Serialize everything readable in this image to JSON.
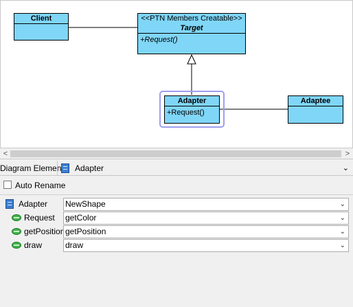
{
  "diagram": {
    "client": {
      "name": "Client"
    },
    "target": {
      "stereotype": "<<PTN Members Creatable>>",
      "name": "Target",
      "operation": "+Request()"
    },
    "adapter": {
      "name": "Adapter",
      "operation": "+Request()"
    },
    "adaptee": {
      "name": "Adaptee"
    }
  },
  "scrollbar": {
    "left_arrow": "<",
    "right_arrow": ">"
  },
  "properties": {
    "header_label": "Diagram Element",
    "selected_element": "Adapter",
    "auto_rename_label": "Auto Rename",
    "auto_rename_checked": false,
    "rows": [
      {
        "icon": "class-icon",
        "label": "Adapter",
        "value": "NewShape"
      },
      {
        "icon": "operation-icon",
        "label": "Request",
        "value": "getColor"
      },
      {
        "icon": "operation-icon",
        "label": "getPosition",
        "value": "getPosition"
      },
      {
        "icon": "operation-icon",
        "label": "draw",
        "value": "draw"
      }
    ]
  },
  "colors": {
    "class_fill": "#7fd6f7",
    "selection": "#9e9ef0"
  }
}
